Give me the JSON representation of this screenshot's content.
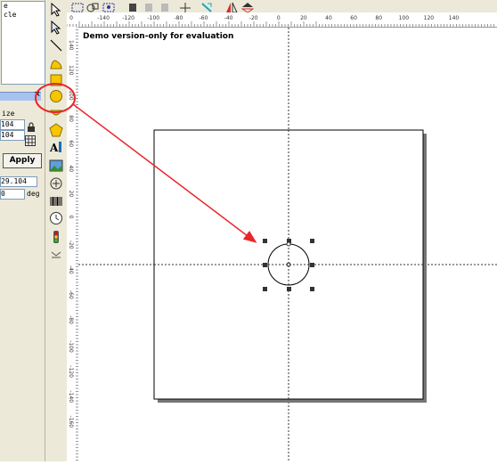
{
  "object_tree": {
    "items": [
      "e",
      "cle"
    ]
  },
  "properties": {
    "size_label": "ize",
    "width_value": "104",
    "height_value": "104",
    "apply_label": "Apply",
    "x_value": "29.104",
    "angle_value": "0",
    "angle_unit": "deg"
  },
  "ruler": {
    "h_labels": [
      "0",
      "-140",
      "-120",
      "-100",
      "-80",
      "-60",
      "-40",
      "-20",
      "0",
      "20",
      "40",
      "60",
      "80",
      "100",
      "120",
      "140"
    ],
    "v_labels": [
      "140",
      "120",
      "100",
      "80",
      "60",
      "40",
      "20",
      "0",
      "-20",
      "-40",
      "-60",
      "-80",
      "-100",
      "-120",
      "-140",
      "-160"
    ]
  },
  "canvas": {
    "watermark": "Demo version-only for evaluation"
  },
  "colors": {
    "highlight": "#e8262a",
    "panel": "#ece9d8",
    "tool_yellow": "#f7c600"
  }
}
